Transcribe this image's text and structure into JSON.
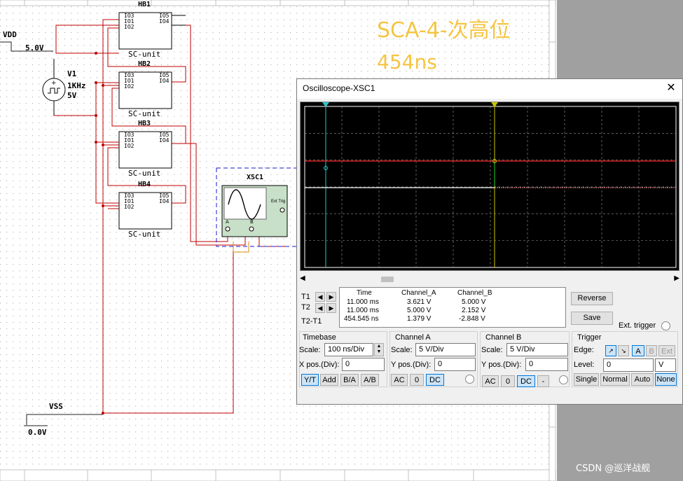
{
  "schematic": {
    "vdd_label": "VDD",
    "vdd_value": "5.0V",
    "vss_label": "VSS",
    "vss_value": "0.0V",
    "source": {
      "name": "V1",
      "freq": "1KHz",
      "amp": "5V"
    },
    "blocks": [
      {
        "name": "HB1",
        "type": "SC-unit",
        "pins_left": [
          "IO3",
          "IO1",
          "IO2"
        ],
        "pins_right": [
          "IO5",
          "IO4"
        ]
      },
      {
        "name": "HB2",
        "type": "SC-unit",
        "pins_left": [
          "IO3",
          "IO1",
          "IO2"
        ],
        "pins_right": [
          "IO5",
          "IO4"
        ]
      },
      {
        "name": "HB3",
        "type": "SC-unit",
        "pins_left": [
          "IO3",
          "IO1",
          "IO2"
        ],
        "pins_right": [
          "IO5",
          "IO4"
        ]
      },
      {
        "name": "HB4",
        "type": "SC-unit",
        "pins_left": [
          "IO3",
          "IO1",
          "IO2"
        ],
        "pins_right": [
          "IO5",
          "IO4"
        ]
      }
    ],
    "scope_name": "XSC1",
    "scope_ext_trig": "Ext Trig",
    "scope_pin_a": "A",
    "scope_pin_b": "B"
  },
  "annotation": {
    "line1": "SCA-4-次高位",
    "line2": "454ns",
    "color": "#f5c542"
  },
  "watermark": "CSDN @巡洋战舰",
  "oscilloscope": {
    "title": "Oscilloscope-XSC1",
    "close_glyph": "✕",
    "cursor_t1_color": "#2ec4c4",
    "cursor_t2_color": "#c8c800",
    "channel_a_color": "#ff2a2a",
    "channel_b_color": "#ffffff",
    "readout": {
      "headers": [
        "Time",
        "Channel_A",
        "Channel_B"
      ],
      "rows": [
        {
          "label": "T1",
          "time": "11.000 ms",
          "a": "3.621 V",
          "b": "5.000 V"
        },
        {
          "label": "T2",
          "time": "11.000 ms",
          "a": "5.000 V",
          "b": "2.152 V"
        },
        {
          "label": "T2-T1",
          "time": "454.545 ns",
          "a": "1.379 V",
          "b": "-2.848 V"
        }
      ]
    },
    "buttons": {
      "reverse": "Reverse",
      "save": "Save",
      "ext_trigger": "Ext. trigger"
    },
    "timebase": {
      "title": "Timebase",
      "scale_label": "Scale:",
      "scale_value": "100 ns/Div",
      "xpos_label": "X pos.(Div):",
      "xpos_value": "0",
      "modes": [
        "Y/T",
        "Add",
        "B/A",
        "A/B"
      ],
      "selected_mode": "Y/T"
    },
    "channel_a": {
      "title": "Channel A",
      "scale_label": "Scale:",
      "scale_value": "5  V/Div",
      "ypos_label": "Y pos.(Div):",
      "ypos_value": "0",
      "coupling": [
        "AC",
        "0",
        "DC"
      ],
      "selected": "DC"
    },
    "channel_b": {
      "title": "Channel B",
      "scale_label": "Scale:",
      "scale_value": "5  V/Div",
      "ypos_label": "Y pos.(Div):",
      "ypos_value": "0",
      "coupling": [
        "AC",
        "0",
        "DC",
        "-"
      ],
      "selected": "DC"
    },
    "trigger": {
      "title": "Trigger",
      "edge_label": "Edge:",
      "edge_buttons": [
        "A",
        "B",
        "Ext"
      ],
      "selected_source": "A",
      "level_label": "Level:",
      "level_value": "0",
      "level_unit": "V",
      "modes": [
        "Single",
        "Normal",
        "Auto",
        "None"
      ],
      "selected_mode": "None"
    }
  }
}
